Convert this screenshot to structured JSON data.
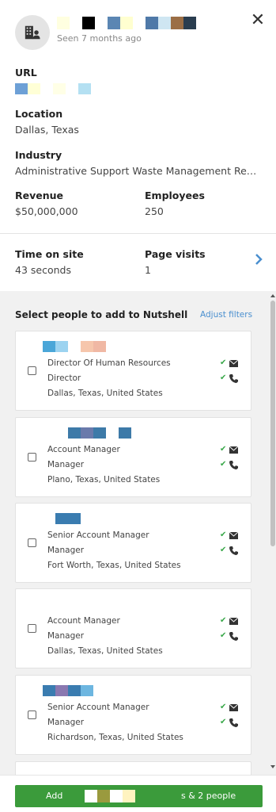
{
  "header": {
    "seen": "Seen 7 months ago",
    "close_glyph": "✕",
    "name_blocks": [
      "#ffffe0",
      "#ffffff",
      "#000000",
      "#ffffff",
      "#5b86b3",
      "#ffffd0",
      "#ffffff",
      "#4f79a8",
      "#cfe6f2",
      "#9b6e45",
      "#2a3d4f"
    ]
  },
  "url": {
    "label": "URL",
    "value_blocks": [
      "#6da0d6",
      "#ffffd6",
      "#ffffff",
      "#ffffe6",
      "#ffffff",
      "#b4e0f2"
    ]
  },
  "location": {
    "label": "Location",
    "value": "Dallas, Texas"
  },
  "industry": {
    "label": "Industry",
    "value": "Administrative Support Waste Management Rem..."
  },
  "revenue": {
    "label": "Revenue",
    "value": "$50,000,000"
  },
  "employees": {
    "label": "Employees",
    "value": "250"
  },
  "time_on_site": {
    "label": "Time on site",
    "value": "43 seconds"
  },
  "page_visits": {
    "label": "Page visits",
    "value": "1"
  },
  "people": {
    "title": "Select people to add to Nutshell",
    "adjust_filters": "Adjust filters",
    "cards": [
      {
        "name_blocks": [
          "#4aa6d8",
          "#9cd3f0",
          "#ffffff",
          "#f6c6ac",
          "#f0b8a4"
        ],
        "title": "Director Of Human Resources",
        "level": "Director",
        "location": "Dallas, Texas, United States"
      },
      {
        "name_blocks": [
          "#ffffff",
          "#ffffff",
          "#3d7aa8",
          "#6a7aab",
          "#3d7aa8",
          "#ffffff",
          "#3d7aa8"
        ],
        "title": "Account Manager",
        "level": "Manager",
        "location": "Plano, Texas, United States"
      },
      {
        "name_blocks": [
          "#ffffff",
          "#3a7cb0",
          "#3a7cb0"
        ],
        "title": "Senior Account Manager",
        "level": "Manager",
        "location": "Fort Worth, Texas, United States"
      },
      {
        "name_blocks": [],
        "title": "Account Manager",
        "level": "Manager",
        "location": "Dallas, Texas, United States"
      },
      {
        "name_blocks": [
          "#3a7cb0",
          "#8a78b0",
          "#3a7cb0",
          "#6db6e0"
        ],
        "title": "Senior Account Manager",
        "level": "Manager",
        "location": "Richardson, Texas, United States"
      }
    ]
  },
  "footer": {
    "add_prefix": "Add",
    "add_suffix": "s & 2 people",
    "button_color": "#3b9b3b",
    "masked_blocks": [
      "#ffffff",
      "#9a9a3e",
      "#ffffff",
      "#fff3c0"
    ]
  },
  "colors": {
    "accent": "#4a8fcf",
    "check": "#3aa84a"
  }
}
